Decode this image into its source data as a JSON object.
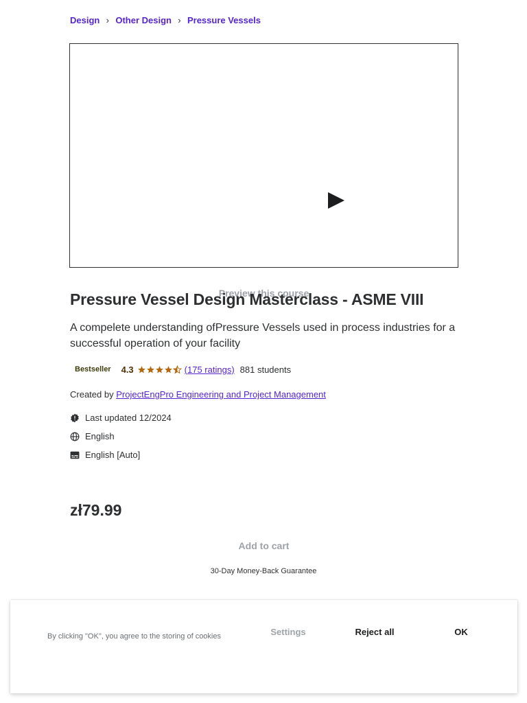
{
  "breadcrumb": {
    "items": [
      "Design",
      "Other Design",
      "Pressure Vessels"
    ],
    "separator": "›"
  },
  "preview": {
    "label": "Preview this course",
    "icon": "play-icon"
  },
  "course": {
    "title": "Pressure Vessel Design Masterclass - ASME VIII",
    "subtitle": "A compelete understanding ofPressure Vessels used in process industries for a successful operation of your facility",
    "badge": "Bestseller",
    "rating": "4.3",
    "rating_value": 4.3,
    "ratings_link": "(175 ratings)",
    "students": "881 students",
    "created_by_label": "Created by",
    "instructor": "ProjectEngPro Engineering and Project Management",
    "last_updated": "Last updated 12/2024",
    "language": "English",
    "captions": "English [Auto]"
  },
  "purchase": {
    "price": "zł79.99",
    "add_to_cart": "Add to cart",
    "guarantee": "30-Day Money-Back Guarantee"
  },
  "cookie_banner": {
    "text": "By clicking \"OK\", you agree to the storing of cookies",
    "settings": "Settings",
    "reject_all": "Reject all",
    "ok": "OK"
  },
  "colors": {
    "link": "#5624d0",
    "star": "#b4690e",
    "text": "#2d2f31",
    "muted": "#9da3a7"
  }
}
